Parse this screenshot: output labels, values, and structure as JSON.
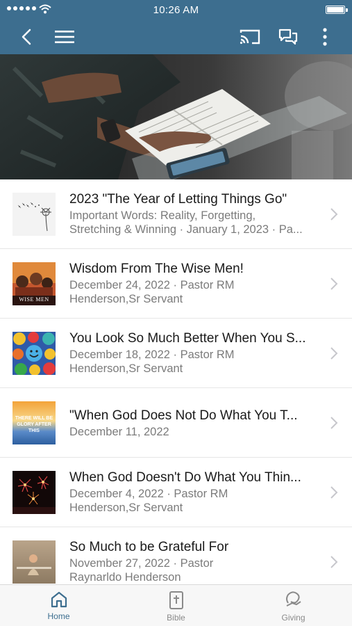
{
  "status_bar": {
    "time": "10:26 AM"
  },
  "sermons": [
    {
      "title": "2023 \"The Year of Letting Things Go\"",
      "subtitle_1": "Important Words: Reality, Forgetting,",
      "subtitle_2": "Stretching & Winning · January 1, 2023 · Pa...",
      "thumb_icon": "dandelion-thumbnail"
    },
    {
      "title": "Wisdom From The Wise Men!",
      "subtitle_1": "December 24, 2022 · Pastor RM",
      "subtitle_2": "Henderson,Sr Servant",
      "thumb_text": "WISE MEN",
      "thumb_icon": "wise-men-thumbnail"
    },
    {
      "title": "You Look So Much Better When You S...",
      "subtitle_1": "December 18, 2022 · Pastor RM",
      "subtitle_2": "Henderson,Sr Servant",
      "thumb_icon": "smiley-faces-thumbnail"
    },
    {
      "title": "\"When God Does Not Do What You T...",
      "subtitle_1": "December 11, 2022",
      "subtitle_2": "",
      "thumb_text_1": "THERE WILL BE",
      "thumb_text_2": "GLORY AFTER THIS",
      "thumb_icon": "sky-thumbnail"
    },
    {
      "title": "When God Doesn't Do What You Thin...",
      "subtitle_1": "December 4, 2022 · Pastor RM",
      "subtitle_2": "Henderson,Sr Servant",
      "thumb_icon": "fireworks-thumbnail"
    },
    {
      "title": "So Much to be Grateful For",
      "subtitle_1": "November 27, 2022 · Pastor",
      "subtitle_2": "Raynarldo Henderson",
      "thumb_icon": "grateful-thumbnail"
    }
  ],
  "tabs": [
    {
      "label": "Home",
      "icon": "home-icon",
      "active": true
    },
    {
      "label": "Bible",
      "icon": "bible-icon",
      "active": false
    },
    {
      "label": "Giving",
      "icon": "giving-icon",
      "active": false
    }
  ],
  "colors": {
    "header": "#3d6e8f",
    "active_tab": "#3d6e8f",
    "inactive_tab": "#8a8a8a"
  }
}
